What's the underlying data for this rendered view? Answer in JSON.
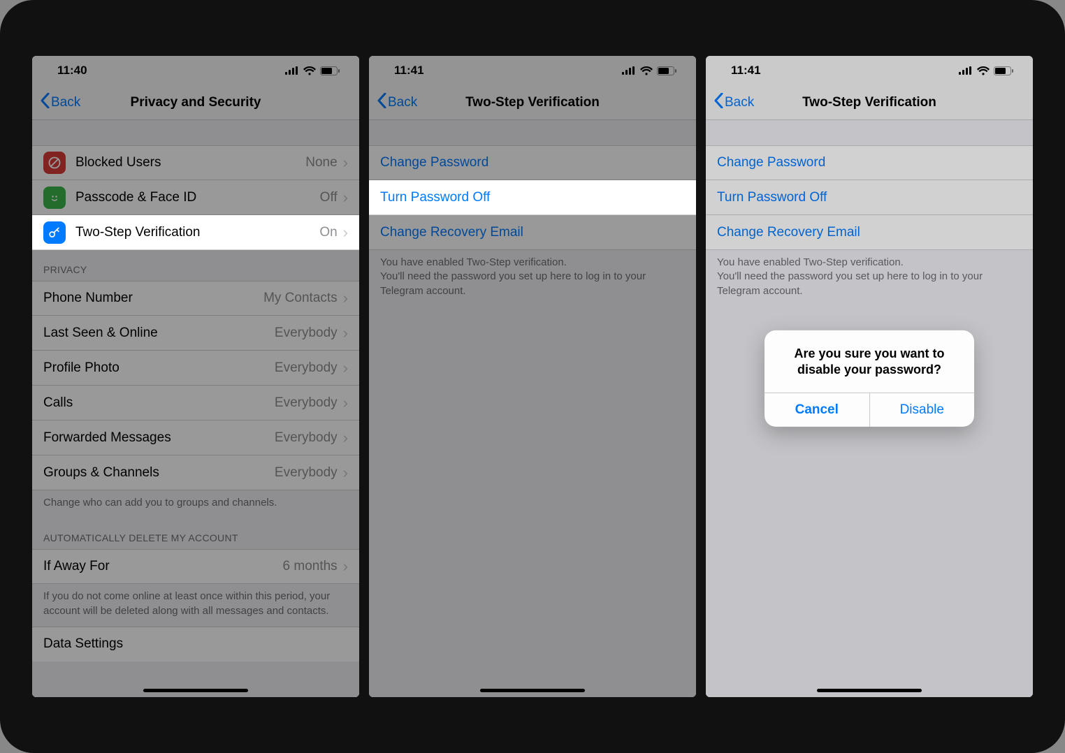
{
  "screen1": {
    "time": "11:40",
    "back": "Back",
    "title": "Privacy and Security",
    "rows_security": [
      {
        "icon": "block",
        "color": "red",
        "label": "Blocked Users",
        "value": "None"
      },
      {
        "icon": "lock",
        "color": "green",
        "label": "Passcode & Face ID",
        "value": "Off"
      },
      {
        "icon": "key",
        "color": "blue",
        "label": "Two-Step Verification",
        "value": "On"
      }
    ],
    "header_privacy": "Privacy",
    "rows_privacy": [
      {
        "label": "Phone Number",
        "value": "My Contacts"
      },
      {
        "label": "Last Seen & Online",
        "value": "Everybody"
      },
      {
        "label": "Profile Photo",
        "value": "Everybody"
      },
      {
        "label": "Calls",
        "value": "Everybody"
      },
      {
        "label": "Forwarded Messages",
        "value": "Everybody"
      },
      {
        "label": "Groups & Channels",
        "value": "Everybody"
      }
    ],
    "footer_privacy": "Change who can add you to groups and channels.",
    "header_delete": "Automatically delete my account",
    "row_delete": {
      "label": "If Away For",
      "value": "6 months"
    },
    "footer_delete": "If you do not come online at least once within this period, your account will be deleted along with all messages and contacts.",
    "row_data": {
      "label": "Data Settings"
    }
  },
  "screen2": {
    "time": "11:41",
    "back": "Back",
    "title": "Two-Step Verification",
    "rows": [
      {
        "label": "Change Password"
      },
      {
        "label": "Turn Password Off"
      },
      {
        "label": "Change Recovery Email"
      }
    ],
    "footer": "You have enabled Two-Step verification.\nYou'll need the password you set up here to log in to your Telegram account."
  },
  "screen3": {
    "time": "11:41",
    "back": "Back",
    "title": "Two-Step Verification",
    "rows": [
      {
        "label": "Change Password"
      },
      {
        "label": "Turn Password Off"
      },
      {
        "label": "Change Recovery Email"
      }
    ],
    "footer": "You have enabled Two-Step verification.\nYou'll need the password you set up here to log in to your Telegram account.",
    "alert": {
      "message": "Are you sure you want to disable your password?",
      "cancel": "Cancel",
      "confirm": "Disable"
    }
  }
}
